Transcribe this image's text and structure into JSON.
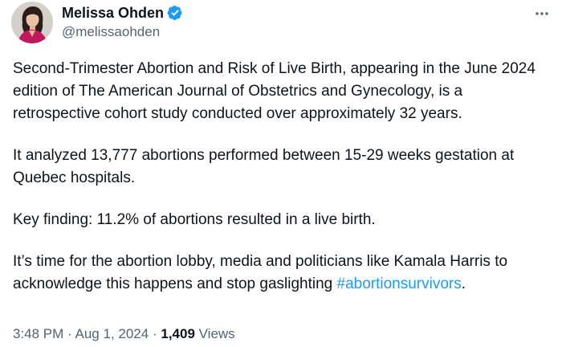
{
  "author": {
    "name": "Melissa Ohden",
    "handle": "@melissaohden",
    "verified": true,
    "verified_color": "#1d9bf0"
  },
  "tweet": {
    "paragraphs": [
      "Second-Trimester Abortion and Risk of Live Birth, appearing in the June 2024 edition of The American Journal of Obstetrics and Gynecology, is a retrospective cohort study conducted over approximately 32 years.",
      "It analyzed 13,777 abortions performed between 15-29 weeks gestation at Quebec hospitals.",
      "Key finding: 11.2% of abortions resulted in a live birth."
    ],
    "last_paragraph_text": "It’s time for the abortion lobby, media and politicians like Kamala Harris to acknowledge this happens and stop gaslighting ",
    "hashtag": "#abortionsurvivors",
    "last_paragraph_end": "."
  },
  "meta": {
    "time": "3:48 PM",
    "separator": "·",
    "date": "Aug 1, 2024",
    "views_count": "1,409",
    "views_label": "Views"
  },
  "icons": {
    "more": "more-horizontal-icon",
    "verified": "verified-badge-icon"
  },
  "colors": {
    "text_primary": "#0f1419",
    "text_secondary": "#536471",
    "link": "#1d9bf0",
    "avatar_outfit": "#c2185b"
  }
}
